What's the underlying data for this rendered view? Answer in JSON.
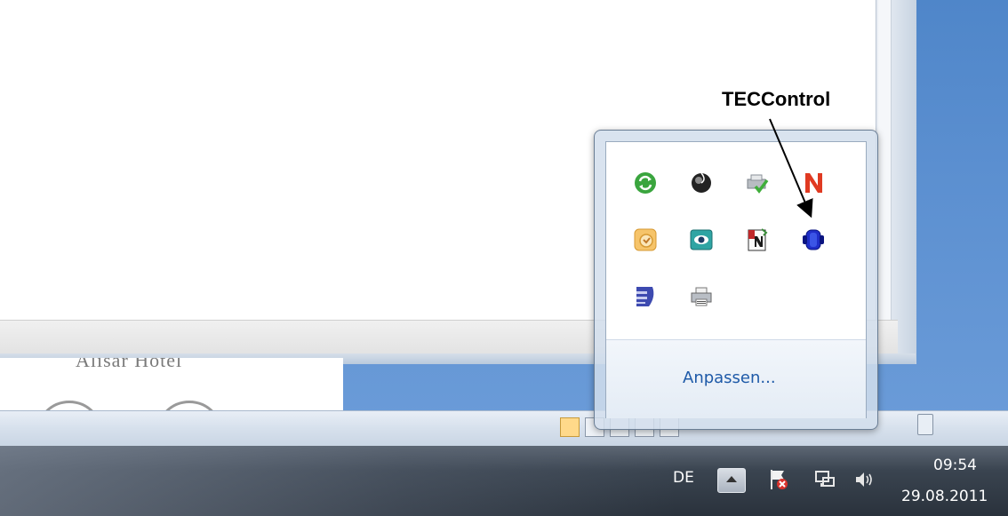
{
  "annotation": {
    "label": "TECControl"
  },
  "tray_popup": {
    "customize_label": "Anpassen...",
    "icons": [
      "sync-arrows-icon",
      "black-orb-icon",
      "printer-check-icon",
      "red-n-icon",
      "orange-clock-icon",
      "teal-eye-icon",
      "notepad-n-icon",
      "teccontrol-icon",
      "blue-shield-icon",
      "printer-icon"
    ]
  },
  "taskbar": {
    "language": "DE",
    "time": "09:54",
    "date": "29.08.2011"
  },
  "colors": {
    "desktop": "#5b8fd0",
    "link": "#1e5aa8",
    "taskbar": "#2a323c"
  }
}
